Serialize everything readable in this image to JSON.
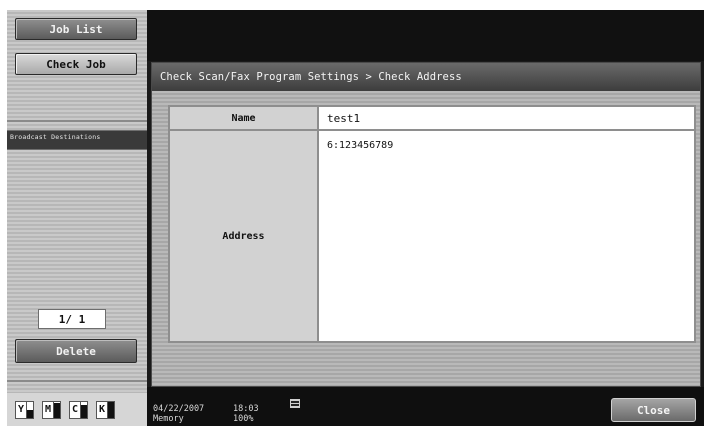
{
  "left_panel": {
    "job_list_label": "Job List",
    "check_job_label": "Check Job",
    "broadcast_label": "Broadcast Destinations",
    "page_counter": "1/  1",
    "delete_label": "Delete",
    "toner": [
      {
        "letter": "Y",
        "level": 0.45
      },
      {
        "letter": "M",
        "level": 0.9
      },
      {
        "letter": "C",
        "level": 0.8
      },
      {
        "letter": "K",
        "level": 0.95
      }
    ]
  },
  "dialog": {
    "title": "Check Scan/Fax Program Settings > Check Address",
    "name_label": "Name",
    "name_value": "test1",
    "address_label": "Address",
    "address_value": "6:123456789"
  },
  "status": {
    "date": "04/22/2007",
    "time": "18:03",
    "mode": "Memory",
    "memory": "100%",
    "close_label": "Close"
  },
  "colors": {
    "background": "#1a1a1a",
    "panel": "#b9b9b9",
    "title_bar": "#4a4a4a"
  }
}
